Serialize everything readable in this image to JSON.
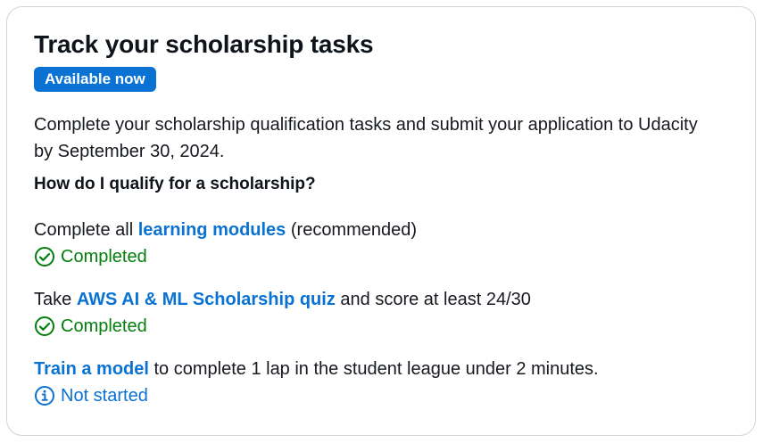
{
  "card": {
    "title": "Track your scholarship tasks",
    "badge": "Available now",
    "description": "Complete your scholarship qualification tasks and submit your application to Udacity by September 30, 2024.",
    "question": "How do I qualify for a scholarship?"
  },
  "tasks": [
    {
      "prefix": "Complete all ",
      "link": "learning modules",
      "suffix": " (recommended)",
      "status": "Completed",
      "status_icon": "check-circle-icon"
    },
    {
      "prefix": "Take ",
      "link": "AWS AI & ML Scholarship quiz",
      "suffix": " and score at least 24/30",
      "status": "Completed",
      "status_icon": "check-circle-icon"
    },
    {
      "prefix": "",
      "link": "Train a model",
      "suffix": " to complete 1 lap in the student league under 2 minutes.",
      "status": "Not started",
      "status_icon": "info-circle-icon"
    }
  ],
  "colors": {
    "accent": "#0972d3",
    "success": "#037f0c",
    "text": "#16191f",
    "border": "#d1d5db"
  }
}
